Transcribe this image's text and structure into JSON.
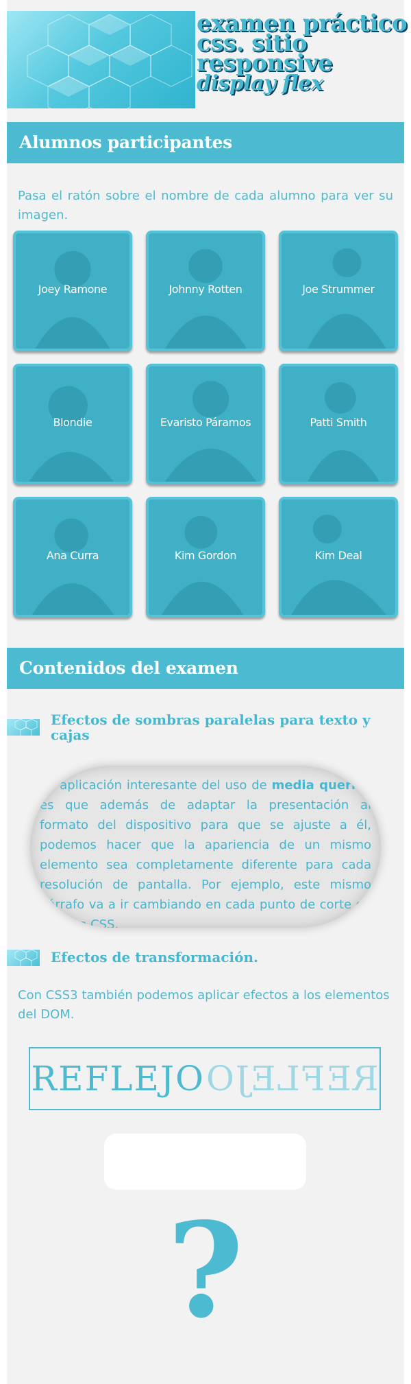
{
  "header": {
    "title_lines": [
      "examen práctico",
      "css. sitio",
      "responsive"
    ],
    "subtitle": "display flex"
  },
  "students_section": {
    "title": "Alumnos participantes",
    "intro": "Pasa el ratón sobre el nombre de cada alumno para ver su imagen.",
    "students": [
      {
        "name": "Joey Ramone"
      },
      {
        "name": "Johnny Rotten"
      },
      {
        "name": "Joe Strummer"
      },
      {
        "name": "Blondie"
      },
      {
        "name": "Evaristo Páramos"
      },
      {
        "name": "Patti Smith"
      },
      {
        "name": "Ana Curra"
      },
      {
        "name": "Kim Gordon"
      },
      {
        "name": "Kim Deal"
      }
    ]
  },
  "contents_section": {
    "title": "Contenidos del examen",
    "shadows": {
      "title": "Efectos de sombras paralelas para texto y cajas",
      "text_before": "na aplicación interesante del uso de ",
      "highlight": "media queries",
      "text_after": " es que además de adaptar la presentación al formato del dispositivo para que se ajuste a él, podemos hacer que la apariencia de un mismo elemento sea completamente diferente para cada resolución de pantalla. Por ejemplo, este mismo párrafo va a ir cambiando en cada punto de corte de nuestro CSS."
    },
    "transform": {
      "title": "Efectos de transformación.",
      "text": "Con CSS3 también podemos aplicar efectos a los elementos del DOM.",
      "reflection_word": "REFLEJO",
      "mirrored_word": "REFLEJO",
      "question_mark": "?"
    }
  },
  "colors": {
    "accent": "#4cbad0",
    "title_shadow": "#0c3f5c",
    "background": "#f2f2f2"
  }
}
